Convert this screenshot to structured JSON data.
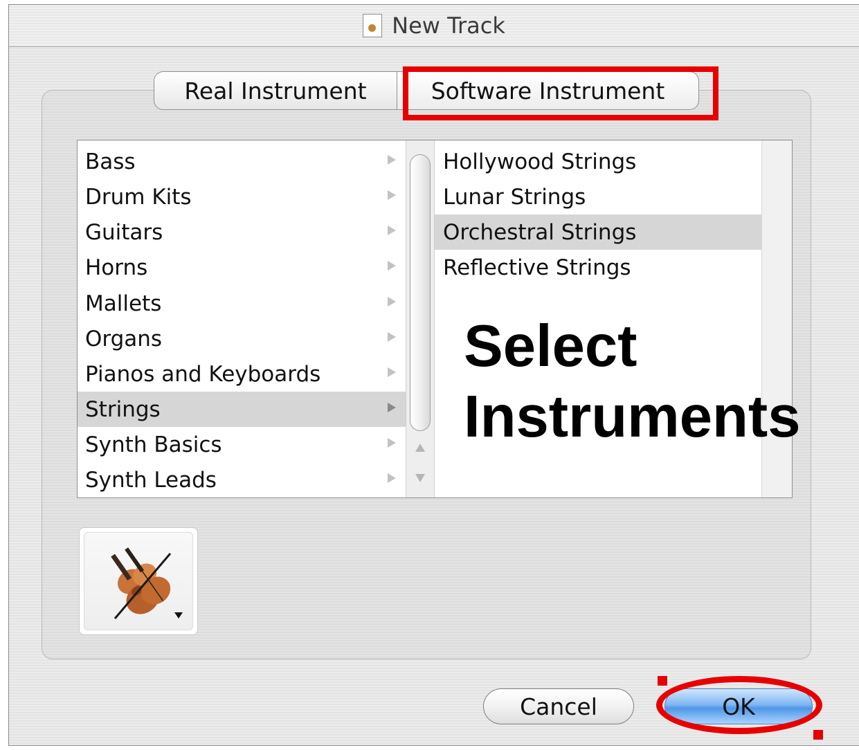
{
  "window": {
    "title": "New Track"
  },
  "tabs": [
    {
      "label": "Real Instrument"
    },
    {
      "label": "Software Instrument"
    }
  ],
  "categories": [
    {
      "label": "Bass"
    },
    {
      "label": "Drum Kits"
    },
    {
      "label": "Guitars"
    },
    {
      "label": "Horns"
    },
    {
      "label": "Mallets"
    },
    {
      "label": "Organs"
    },
    {
      "label": "Pianos and Keyboards"
    },
    {
      "label": "Strings"
    },
    {
      "label": "Synth Basics"
    },
    {
      "label": "Synth Leads"
    }
  ],
  "selected_category": "Strings",
  "instruments": [
    {
      "label": "Hollywood Strings"
    },
    {
      "label": "Lunar Strings"
    },
    {
      "label": "Orchestral Strings"
    },
    {
      "label": "Reflective Strings"
    }
  ],
  "selected_instrument": "Orchestral Strings",
  "annotation": {
    "line1": "Select",
    "line2": "Instruments"
  },
  "track_icon": {
    "icon": "violin-icon"
  },
  "buttons": {
    "cancel": "Cancel",
    "ok": "OK"
  },
  "colors": {
    "highlight": "#e80000",
    "default_button": "#4f97e6",
    "selection": "#d6d6d6"
  }
}
